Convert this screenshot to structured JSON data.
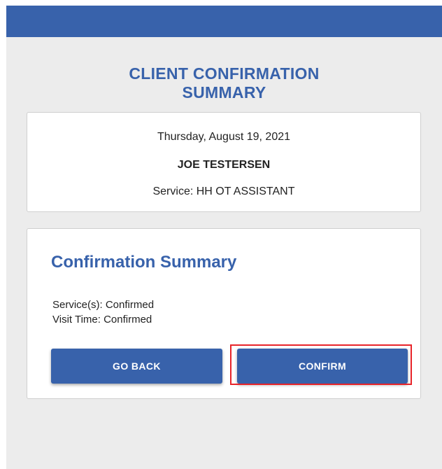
{
  "header": {
    "title": "CLIENT CONFIRMATION\nSUMMARY"
  },
  "visit": {
    "date": "Thursday, August 19, 2021",
    "client_name": "JOE TESTERSEN",
    "service": "Service: HH OT ASSISTANT"
  },
  "summary": {
    "title": "Confirmation Summary",
    "services_status": "Service(s): Confirmed",
    "visit_time_status": "Visit Time: Confirmed",
    "go_back_label": "GO BACK",
    "confirm_label": "CONFIRM"
  },
  "colors": {
    "brand_blue": "#3862ab",
    "background": "#ececec",
    "highlight": "#e8242a"
  }
}
